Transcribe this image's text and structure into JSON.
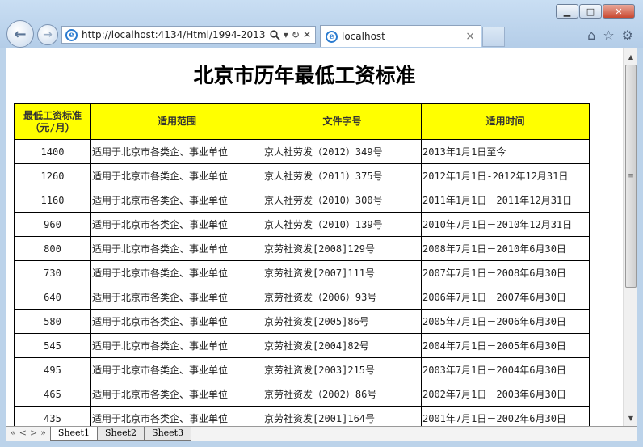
{
  "browser": {
    "address": "http://localhost:4134/Html/1994-2013",
    "tab_title": "localhost",
    "window_buttons": {
      "minimize": "▁",
      "maximize": "□",
      "close": "✕"
    }
  },
  "icons": {
    "back": "back-arrow-icon",
    "forward": "forward-arrow-icon",
    "search": "search-icon",
    "refresh": "refresh-icon",
    "home": "home-icon",
    "favorites": "star-icon",
    "settings": "gear-icon"
  },
  "page": {
    "title": "北京市历年最低工资标准"
  },
  "table": {
    "header_color": "#ffff00",
    "headers": [
      "最低工资标准\n（元/月）",
      "适用范围",
      "文件字号",
      "适用时间"
    ],
    "rows": [
      [
        "1400",
        "适用于北京市各类企、事业单位",
        "京人社劳发（2012）349号",
        "2013年1月1日至今"
      ],
      [
        "1260",
        "适用于北京市各类企、事业单位",
        "京人社劳发（2011）375号",
        "2012年1月1日-2012年12月31日"
      ],
      [
        "1160",
        "适用于北京市各类企、事业单位",
        "京人社劳发（2010）300号",
        "2011年1月1日－2011年12月31日"
      ],
      [
        "960",
        "适用于北京市各类企、事业单位",
        "京人社劳发（2010）139号",
        "2010年7月1日－2010年12月31日"
      ],
      [
        "800",
        "适用于北京市各类企、事业单位",
        "京劳社资发[2008]129号",
        "2008年7月1日－2010年6月30日"
      ],
      [
        "730",
        "适用于北京市各类企、事业单位",
        "京劳社资发[2007]111号",
        "2007年7月1日－2008年6月30日"
      ],
      [
        "640",
        "适用于北京市各类企、事业单位",
        "京劳社资发（2006）93号",
        "2006年7月1日－2007年6月30日"
      ],
      [
        "580",
        "适用于北京市各类企、事业单位",
        "京劳社资发[2005]86号",
        "2005年7月1日－2006年6月30日"
      ],
      [
        "545",
        "适用于北京市各类企、事业单位",
        "京劳社资发[2004]82号",
        "2004年7月1日－2005年6月30日"
      ],
      [
        "495",
        "适用于北京市各类企、事业单位",
        "京劳社资发[2003]215号",
        "2003年7月1日－2004年6月30日"
      ],
      [
        "465",
        "适用于北京市各类企、事业单位",
        "京劳社资发（2002）86号",
        "2002年7月1日－2003年6月30日"
      ],
      [
        "435",
        "适用于北京市各类企、事业单位",
        "京劳社资发[2001]164号",
        "2001年7月1日－2002年6月30日"
      ]
    ]
  },
  "sheets": {
    "nav": [
      "«",
      "<",
      ">",
      "»"
    ],
    "tabs": [
      "Sheet1",
      "Sheet2",
      "Sheet3"
    ],
    "active": "Sheet1"
  }
}
